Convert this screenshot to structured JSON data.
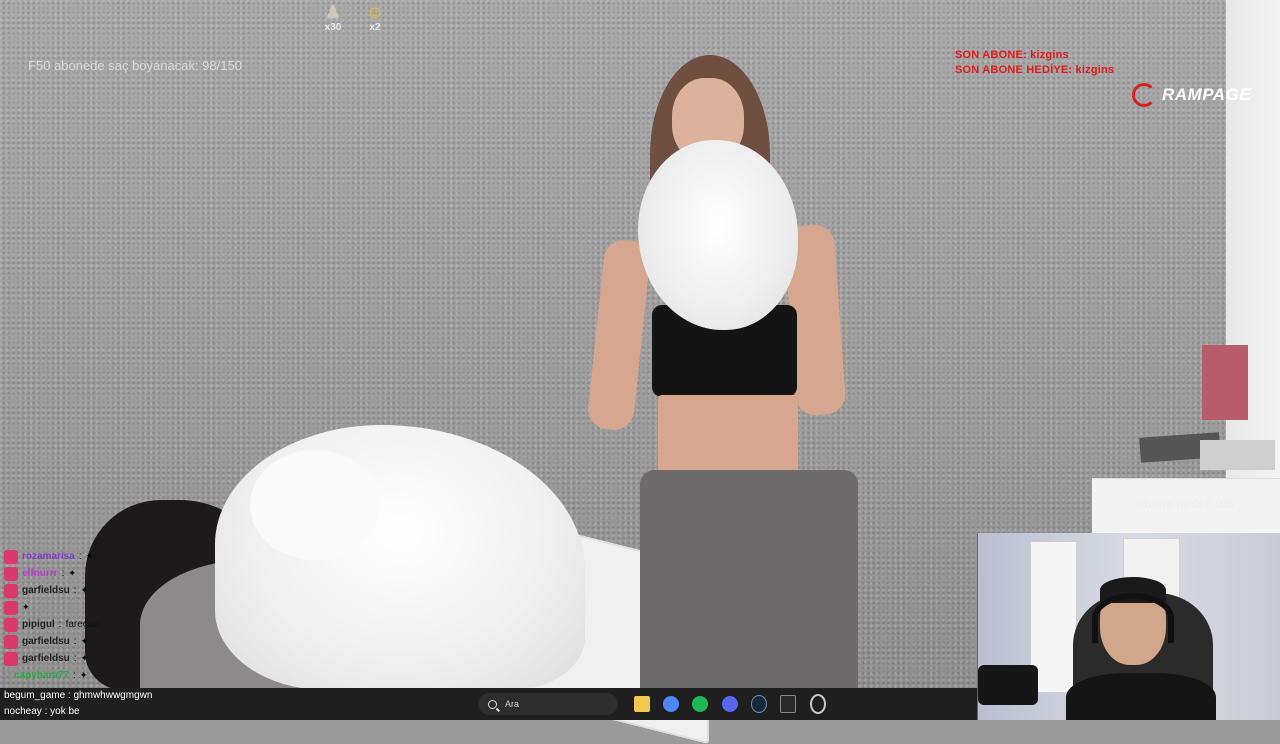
{
  "overlay": {
    "goal_text": "F50 abonede saç boyanacak: 98/150",
    "badges": [
      {
        "icon": "figure-icon",
        "count": "x30"
      },
      {
        "icon": "emoji-icon",
        "count": "x2"
      }
    ],
    "sub_info": {
      "last_sub": "SON ABONE: kizgins",
      "last_gift": "SON ABONE HEDİYE: kizgins"
    },
    "brand": "RAMPAGE",
    "sub_goal": "abone hedefi 0/5",
    "accent_color": "#e01b1b"
  },
  "chat": {
    "messages": [
      {
        "user": "rozamarisa",
        "message": "",
        "color": "#7a3cc7"
      },
      {
        "user": "elfnurrr",
        "message": "",
        "color": "#b23cc7"
      },
      {
        "user": "garfieldsu",
        "message": "",
        "color": "#222222"
      },
      {
        "user": "",
        "message": "",
        "color": "#222222"
      },
      {
        "user": "pipigul",
        "message": "farecan",
        "color": "#222222"
      },
      {
        "user": "garfieldsu",
        "message": "",
        "color": "#222222"
      },
      {
        "user": "garfieldsu",
        "message": "",
        "color": "#222222"
      },
      {
        "user": "capybara77",
        "message": "",
        "color": "#2aa84a"
      }
    ],
    "bottom_lines": [
      {
        "user": "begum_game",
        "message": "ghmwhwwgmgwn"
      },
      {
        "user": "nocheay",
        "message": "yok be"
      }
    ]
  },
  "taskbar": {
    "search_placeholder": "Ara",
    "apps": [
      "file-explorer-icon",
      "chrome-icon",
      "spotify-icon",
      "discord-icon",
      "steam-icon",
      "epic-games-icon",
      "obs-icon"
    ],
    "app_colors": [
      "#f2c94c",
      "#4a8af4",
      "#1db954",
      "#5865f2",
      "#1b2838",
      "#2a2a2a",
      "#c7c7c7"
    ]
  }
}
